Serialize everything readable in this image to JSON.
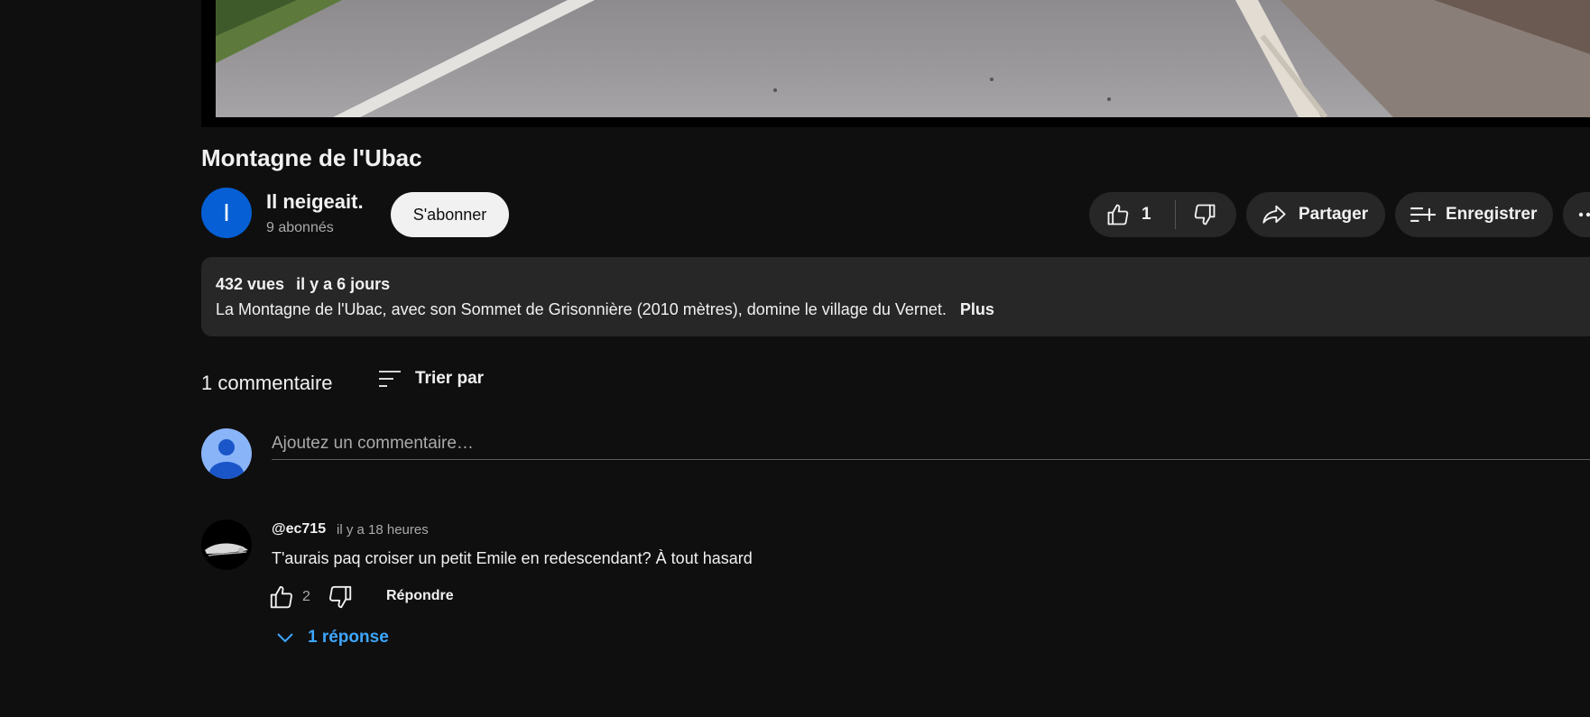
{
  "video": {
    "title": "Montagne de l'Ubac"
  },
  "channel": {
    "avatar_letter": "I",
    "name": "Il neigeait.",
    "subscribers": "9 abonnés",
    "subscribe_label": "S'abonner"
  },
  "actions": {
    "like_count": "1",
    "share_label": "Partager",
    "save_label": "Enregistrer",
    "more_icon": "more-horizontal-icon"
  },
  "description": {
    "views": "432 vues",
    "date": "il y a 6 jours",
    "text": "La Montagne de l'Ubac, avec son Sommet de Grisonnière (2010 mètres), domine le village du Vernet.",
    "more_label": "Plus"
  },
  "comments": {
    "count_label": "1 commentaire",
    "sort_label": "Trier par",
    "input_placeholder": "Ajoutez un commentaire…",
    "items": [
      {
        "author": "@ec715",
        "time": "il y a 18 heures",
        "text": "T'aurais paq croiser un petit Emile en redescendant? À tout hasard",
        "like_count": "2",
        "reply_label": "Répondre",
        "replies_label": "1 réponse"
      }
    ]
  },
  "colors": {
    "background": "#0f0f0f",
    "pill": "#272727",
    "link_blue": "#3ea6ff",
    "channel_avatar": "#065fd4"
  }
}
